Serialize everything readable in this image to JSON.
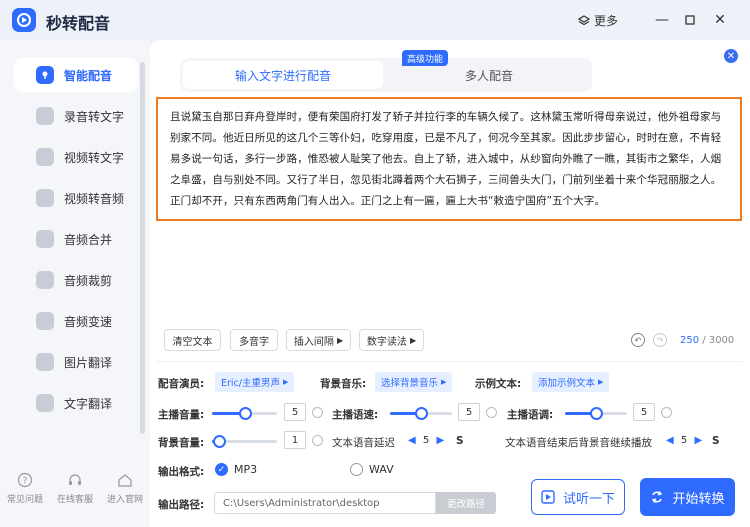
{
  "app": {
    "title": "秒转配音",
    "more_label": "更多"
  },
  "sidebar": {
    "items": [
      {
        "label": "智能配音",
        "active": true
      },
      {
        "label": "录音转文字"
      },
      {
        "label": "视频转文字"
      },
      {
        "label": "视频转音频"
      },
      {
        "label": "音频合并"
      },
      {
        "label": "音频裁剪"
      },
      {
        "label": "音频变速"
      },
      {
        "label": "图片翻译"
      },
      {
        "label": "文字翻译"
      }
    ],
    "bottom": [
      {
        "label": "常见问题"
      },
      {
        "label": "在线客服"
      },
      {
        "label": "进入官网"
      }
    ]
  },
  "tabs": [
    {
      "label": "输入文字进行配音",
      "active": true
    },
    {
      "label": "多人配音"
    }
  ],
  "badge": "高级功能",
  "text_content": "且说黛玉自那日弃舟登岸时，便有荣国府打发了轿子并拉行李的车辆久候了。这林黛玉常听得母亲说过，他外祖母家与别家不同。他近日所见的这几个三等仆妇，吃穿用度，已是不凡了，何况今至其家。因此步步留心，时时在意，不肯轻易多说一句话，多行一步路，惟恐被人耻笑了他去。自上了轿，进入城中，从纱窗向外瞧了一瞧，其街市之繁华，人烟之阜盛，自与别处不同。又行了半日，忽见街北蹲着两个大石狮子，三间兽头大门，门前列坐着十来个华冠丽服之人。正门却不开，只有东西两角门有人出入。正门之上有一匾，匾上大书“敕造宁国府”五个大字。",
  "toolbar": {
    "clear": "清空文本",
    "polyphone": "多音字",
    "insert_pause": "插入间隔",
    "number_read": "数字读法"
  },
  "counter": {
    "current": "250",
    "total": "/ 3000"
  },
  "settings": {
    "voice_label": "配音演员:",
    "voice_value": "Eric/主重男声",
    "bgm_label": "背景音乐:",
    "bgm_value": "选择背景音乐",
    "sample_label": "示例文本:",
    "sample_value": "添加示例文本",
    "volume_label": "主播音量:",
    "volume_value": "5",
    "speed_label": "主播语速:",
    "speed_value": "5",
    "tone_label": "主播语调:",
    "tone_value": "5",
    "bgvol_label": "背景音量:",
    "bgvol_value": "1",
    "delay_label": "文本语音延迟",
    "delay_value": "5",
    "delay_unit": "S",
    "continue_label": "文本语音结束后背景音继续播放",
    "continue_value": "5",
    "continue_unit": "S",
    "format_label": "输出格式:",
    "format_mp3": "MP3",
    "format_wav": "WAV",
    "path_label": "输出路径:",
    "path_value": "C:\\Users\\Administrator\\desktop",
    "path_button": "更改路径"
  },
  "sliders": {
    "volume": 0.5,
    "speed": 0.5,
    "tone": 0.5,
    "bgvolume": 0.1
  },
  "actions": {
    "listen": "试听一下",
    "start": "开始转换"
  },
  "colors": {
    "accent": "#2f6bff",
    "highlight_border": "#f07a1e"
  }
}
